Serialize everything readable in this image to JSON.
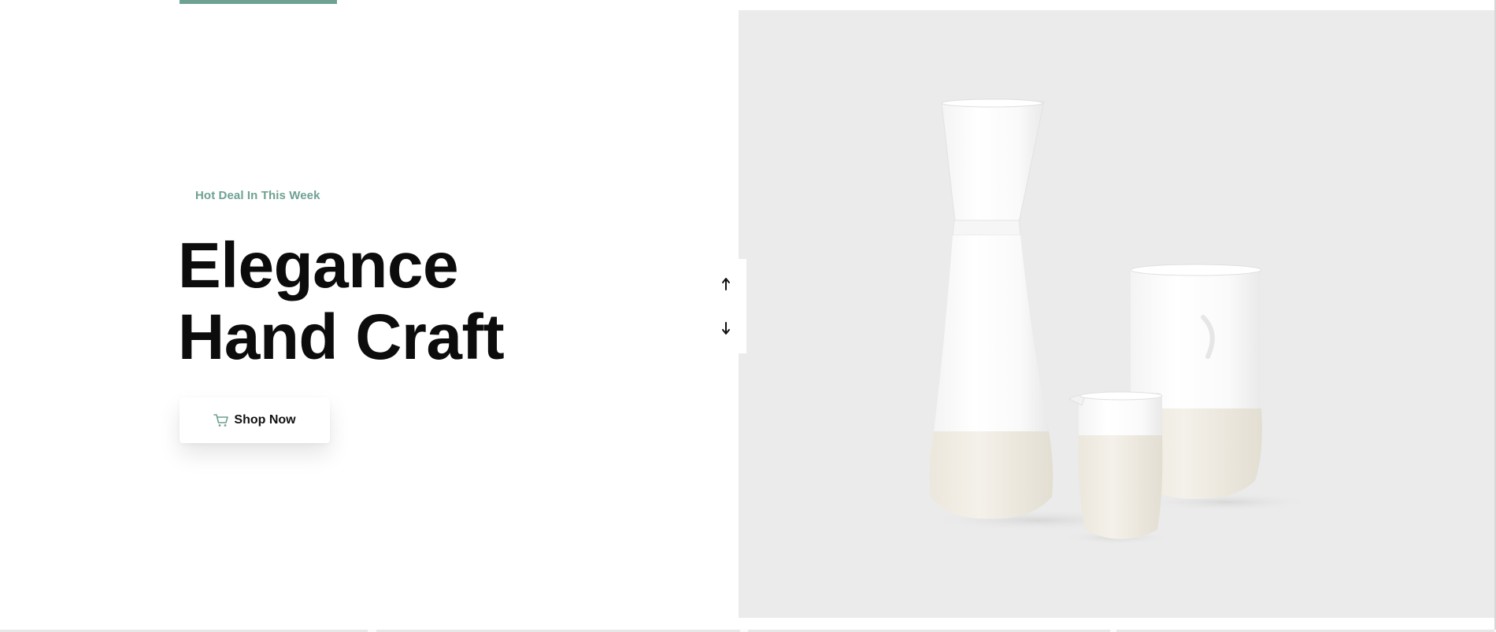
{
  "hero": {
    "kicker": "Hot Deal In This Week",
    "headline_line1": "Elegance",
    "headline_line2": "Hand Craft",
    "cta_label": "Shop Now",
    "cta_icon": "cart-icon",
    "image_alt": "white ceramic pour-over carafe, cup and small jug"
  },
  "slider": {
    "prev_icon": "arrow-up-icon",
    "next_icon": "arrow-down-icon"
  },
  "colors": {
    "accent": "#6fa193",
    "text": "#0c0c0c",
    "image_bg": "#ebebeb"
  }
}
